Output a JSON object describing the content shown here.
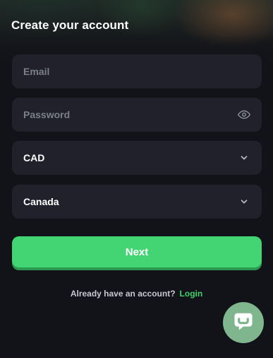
{
  "form": {
    "title": "Create your account",
    "email": {
      "placeholder": "Email",
      "value": ""
    },
    "password": {
      "placeholder": "Password",
      "value": "",
      "icon": "eye-icon"
    },
    "currency": {
      "selected": "CAD",
      "icon": "chevron-down-icon"
    },
    "country": {
      "selected": "Canada",
      "icon": "chevron-down-icon"
    },
    "next_label": "Next"
  },
  "footer": {
    "question": "Already have an account?",
    "login_label": "Login"
  },
  "chat": {
    "icon": "chat-bubble-icon"
  },
  "colors": {
    "accent": "#43d473",
    "background": "#121319",
    "field": "#20212a",
    "link": "#3fd16c",
    "chat": "#7fb68e"
  }
}
